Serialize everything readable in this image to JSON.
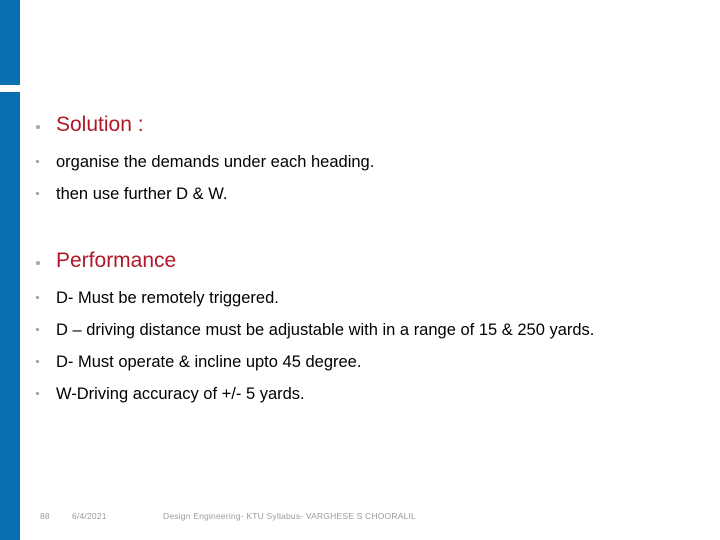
{
  "slide": {
    "accent_color": "#0A6FB0",
    "heading_color": "#B01828",
    "body_color": "#000000",
    "background_color": "#FFFFFF",
    "blocks": [
      {
        "heading": "Solution :",
        "items": [
          "organise the demands under each heading.",
          "then use further D & W."
        ]
      },
      {
        "heading": "Performance",
        "items": [
          "D- Must be remotely triggered.",
          "D – driving distance must be adjustable with in a range of 15 & 250 yards.",
          "D- Must operate & incline upto 45 degree.",
          "W-Driving accuracy of +/- 5 yards."
        ]
      }
    ]
  },
  "footer": {
    "slide_number": "88",
    "date": "6/4/2021",
    "title": "Design Engineering- KTU Syllabus- VARGHESE S CHOORALIL"
  }
}
